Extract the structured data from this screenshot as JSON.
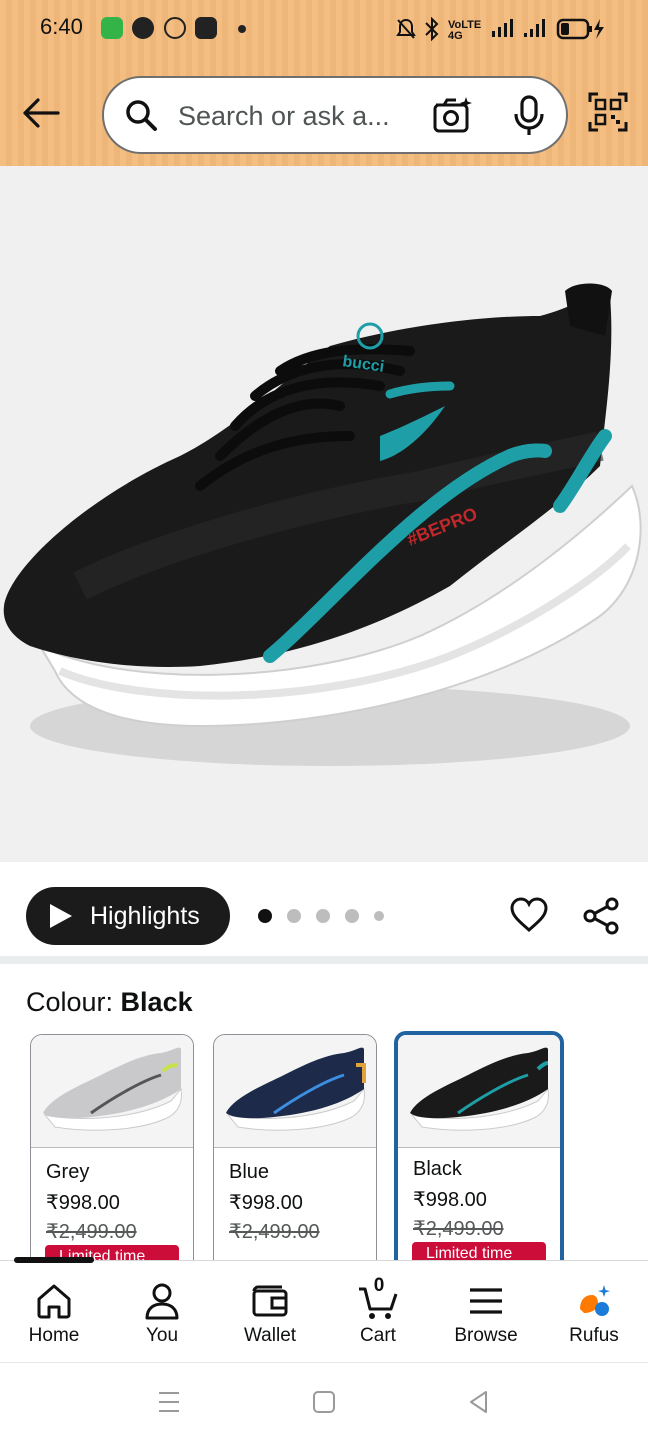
{
  "status_bar": {
    "time": "6:40",
    "right_indicators": "VoLTE 4G"
  },
  "search": {
    "placeholder": "Search or ask a..."
  },
  "highlights": {
    "label": "Highlights",
    "dots_total": 5,
    "active_dot": 1
  },
  "colour": {
    "label": "Colour: ",
    "selected": "Black",
    "options": [
      {
        "name": "Grey",
        "price": "₹998.00",
        "mrp": "₹2,499.00",
        "deal": "Limited time deal"
      },
      {
        "name": "Blue",
        "price": "₹998.00",
        "mrp": "₹2,499.00",
        "deal": ""
      },
      {
        "name": "Black",
        "price": "₹998.00",
        "mrp": "₹2,499.00",
        "deal": "Limited time deal"
      }
    ]
  },
  "cart_count": "0",
  "nav": [
    {
      "label": "Home",
      "icon": "home-icon"
    },
    {
      "label": "You",
      "icon": "person-icon"
    },
    {
      "label": "Wallet",
      "icon": "wallet-icon"
    },
    {
      "label": "Cart",
      "icon": "cart-icon"
    },
    {
      "label": "Browse",
      "icon": "menu-icon"
    },
    {
      "label": "Rufus",
      "icon": "rufus-icon"
    }
  ],
  "colors": {
    "header": "#f3b97a",
    "accent_selected": "#2162a1",
    "deal_red": "#cc0c39",
    "shoe_teal": "#1e9fa8"
  }
}
